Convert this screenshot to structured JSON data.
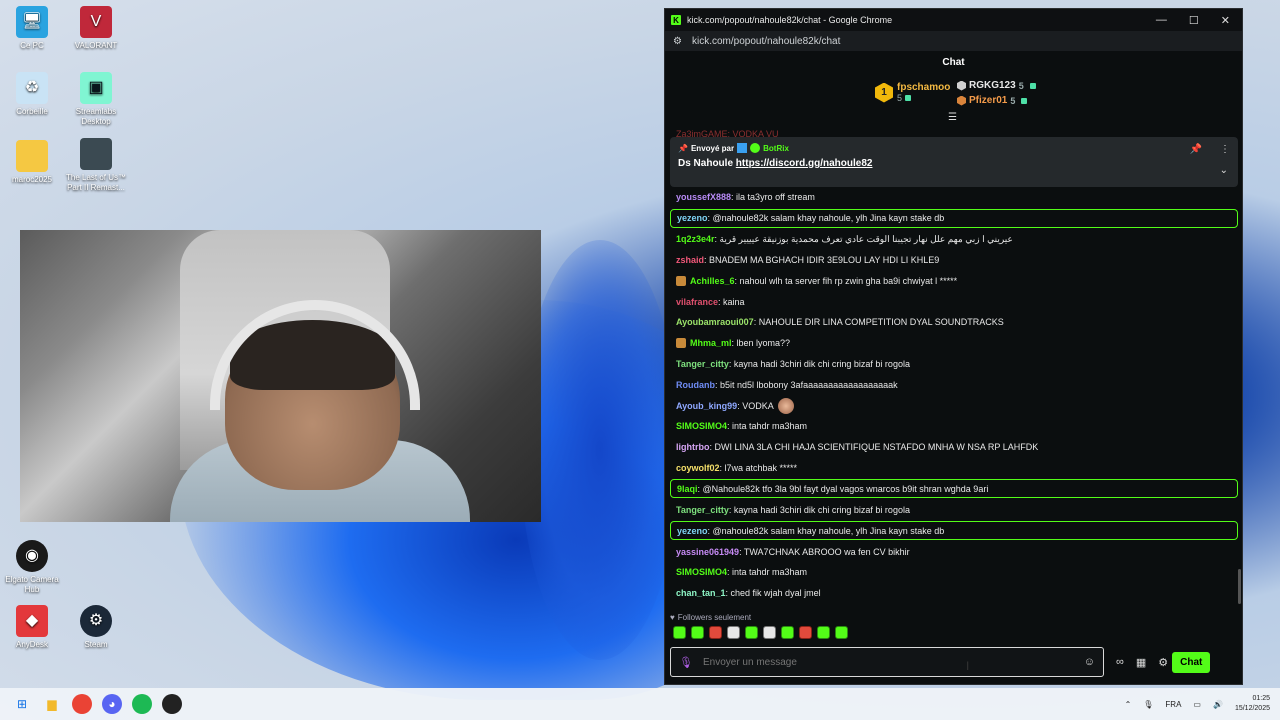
{
  "desktop": {
    "icons": [
      {
        "label": "Ce PC"
      },
      {
        "label": "VALORANT"
      },
      {
        "label": "Corbeille"
      },
      {
        "label": "Streamlabs Desktop"
      },
      {
        "label": "maroc2025"
      },
      {
        "label": "The Last of Us™ Part II Remast..."
      },
      {
        "label": "Elgato Camera Hub"
      },
      {
        "label": "AnyDesk"
      },
      {
        "label": "Steam"
      }
    ]
  },
  "browser": {
    "window_title": "kick.com/popout/nahoule82k/chat - Google Chrome",
    "address": "kick.com/popout/nahoule82k/chat"
  },
  "chat": {
    "header": "Chat",
    "leaderboard": {
      "first": {
        "rank": "1",
        "name": "fpschamoo",
        "count": "5"
      },
      "second": {
        "name": "RGKG123",
        "count": "5"
      },
      "third": {
        "name": "Pfizer01",
        "count": "5"
      }
    },
    "cut_message": "Za3imGAME: VODKA VU",
    "pinned": {
      "sent_by_label": "Envoyé par",
      "bot_name": "BotRix",
      "text": "Ds Nahoule",
      "link": "https://discord.gg/nahoule82"
    },
    "messages": [
      {
        "user": "youssefX888",
        "color": "#b98bf7",
        "text": ": ila ta3yro off stream",
        "highlight": false
      },
      {
        "user": "yezeno",
        "color": "#7fd4f5",
        "text": ": @nahoule82k salam khay nahoule, ylh Jina kayn stake db",
        "highlight": true
      },
      {
        "user": "1q2z3e4r",
        "color": "#53fc18",
        "text": ": عيريني ا زبي مهم علل نهار تجيبنا الوقت عادي تعرف محمدية بوزنيقة عيييير قرية",
        "highlight": false
      },
      {
        "user": "zshaid",
        "color": "#f2587a",
        "text": ": BNADEM MA BGHACH IDIR 3E9LOU LAY HDI LI KHLE9",
        "highlight": false
      },
      {
        "user": "Achilles_6",
        "color": "#53fc18",
        "text": ": nahoul wlh ta server fih rp zwin gha ba9i chwiyat l *****",
        "highlight": false,
        "badge": true
      },
      {
        "user": "vilafrance",
        "color": "#e0506e",
        "text": ": kaina",
        "highlight": false
      },
      {
        "user": "Ayoubamraoui007",
        "color": "#9be36a",
        "text": ": NAHOULE DIR LINA COMPETITION DYAL SOUNDTRACKS",
        "highlight": false
      },
      {
        "user": "Mhma_ml",
        "color": "#53fc18",
        "text": ": lben lyoma??",
        "highlight": false,
        "badge": true
      },
      {
        "user": "Tanger_citty",
        "color": "#7ee07e",
        "text": ": kayna hadi 3chiri dik chi cring bizaf bi rogola",
        "highlight": false
      },
      {
        "user": "Roudanb",
        "color": "#6f8cf5",
        "text": ": b5it nd5l lbobony 3afaaaaaaaaaaaaaaaaaak",
        "highlight": false
      },
      {
        "user": "Ayoub_king99",
        "color": "#8fa8ff",
        "text": ": VODKA",
        "highlight": false,
        "emote": true
      },
      {
        "user": "SIMOSIMO4",
        "color": "#53fc18",
        "text": ": inta tahdr ma3ham",
        "highlight": false
      },
      {
        "user": "lightrbo",
        "color": "#d7a6f5",
        "text": ": DWI LINA 3LA CHI HAJA SCIENTIFIQUE NSTAFDO MNHA W NSA RP LAHFDK",
        "highlight": false
      },
      {
        "user": "coywolf02",
        "color": "#f5e06a",
        "text": ": l7wa atchbak *****",
        "highlight": false
      },
      {
        "user": "9laqi",
        "color": "#53fc18",
        "text": ": @Nahoule82k tfo 3la 9bl fayt dyal vagos wnarcos b9it shran wghda 9ari",
        "highlight": true
      },
      {
        "user": "Tanger_citty",
        "color": "#7ee07e",
        "text": ": kayna hadi 3chiri dik chi cring bizaf bi rogola",
        "highlight": false
      },
      {
        "user": "yezeno",
        "color": "#7fd4f5",
        "text": ": @nahoule82k salam khay nahoule, ylh Jina kayn stake db",
        "highlight": true
      },
      {
        "user": "yassine061949",
        "color": "#c78bf5",
        "text": ": TWA7CHNAK ABROOO wa fen CV bikhir",
        "highlight": false
      },
      {
        "user": "SIMOSIMO4",
        "color": "#53fc18",
        "text": ": inta tahdr ma3ham",
        "highlight": false
      },
      {
        "user": "chan_tan_1",
        "color": "#8ef5c6",
        "text": ": ched fik wjah dyal jmel",
        "highlight": false
      }
    ],
    "followers_only": "Followers seulement",
    "input_placeholder": "Envoyer un message",
    "send_label": "Chat"
  },
  "taskbar": {
    "language": "FRA",
    "time": "01:25",
    "date": "15/12/2025"
  },
  "colors": {
    "kick_green": "#53fc18"
  }
}
